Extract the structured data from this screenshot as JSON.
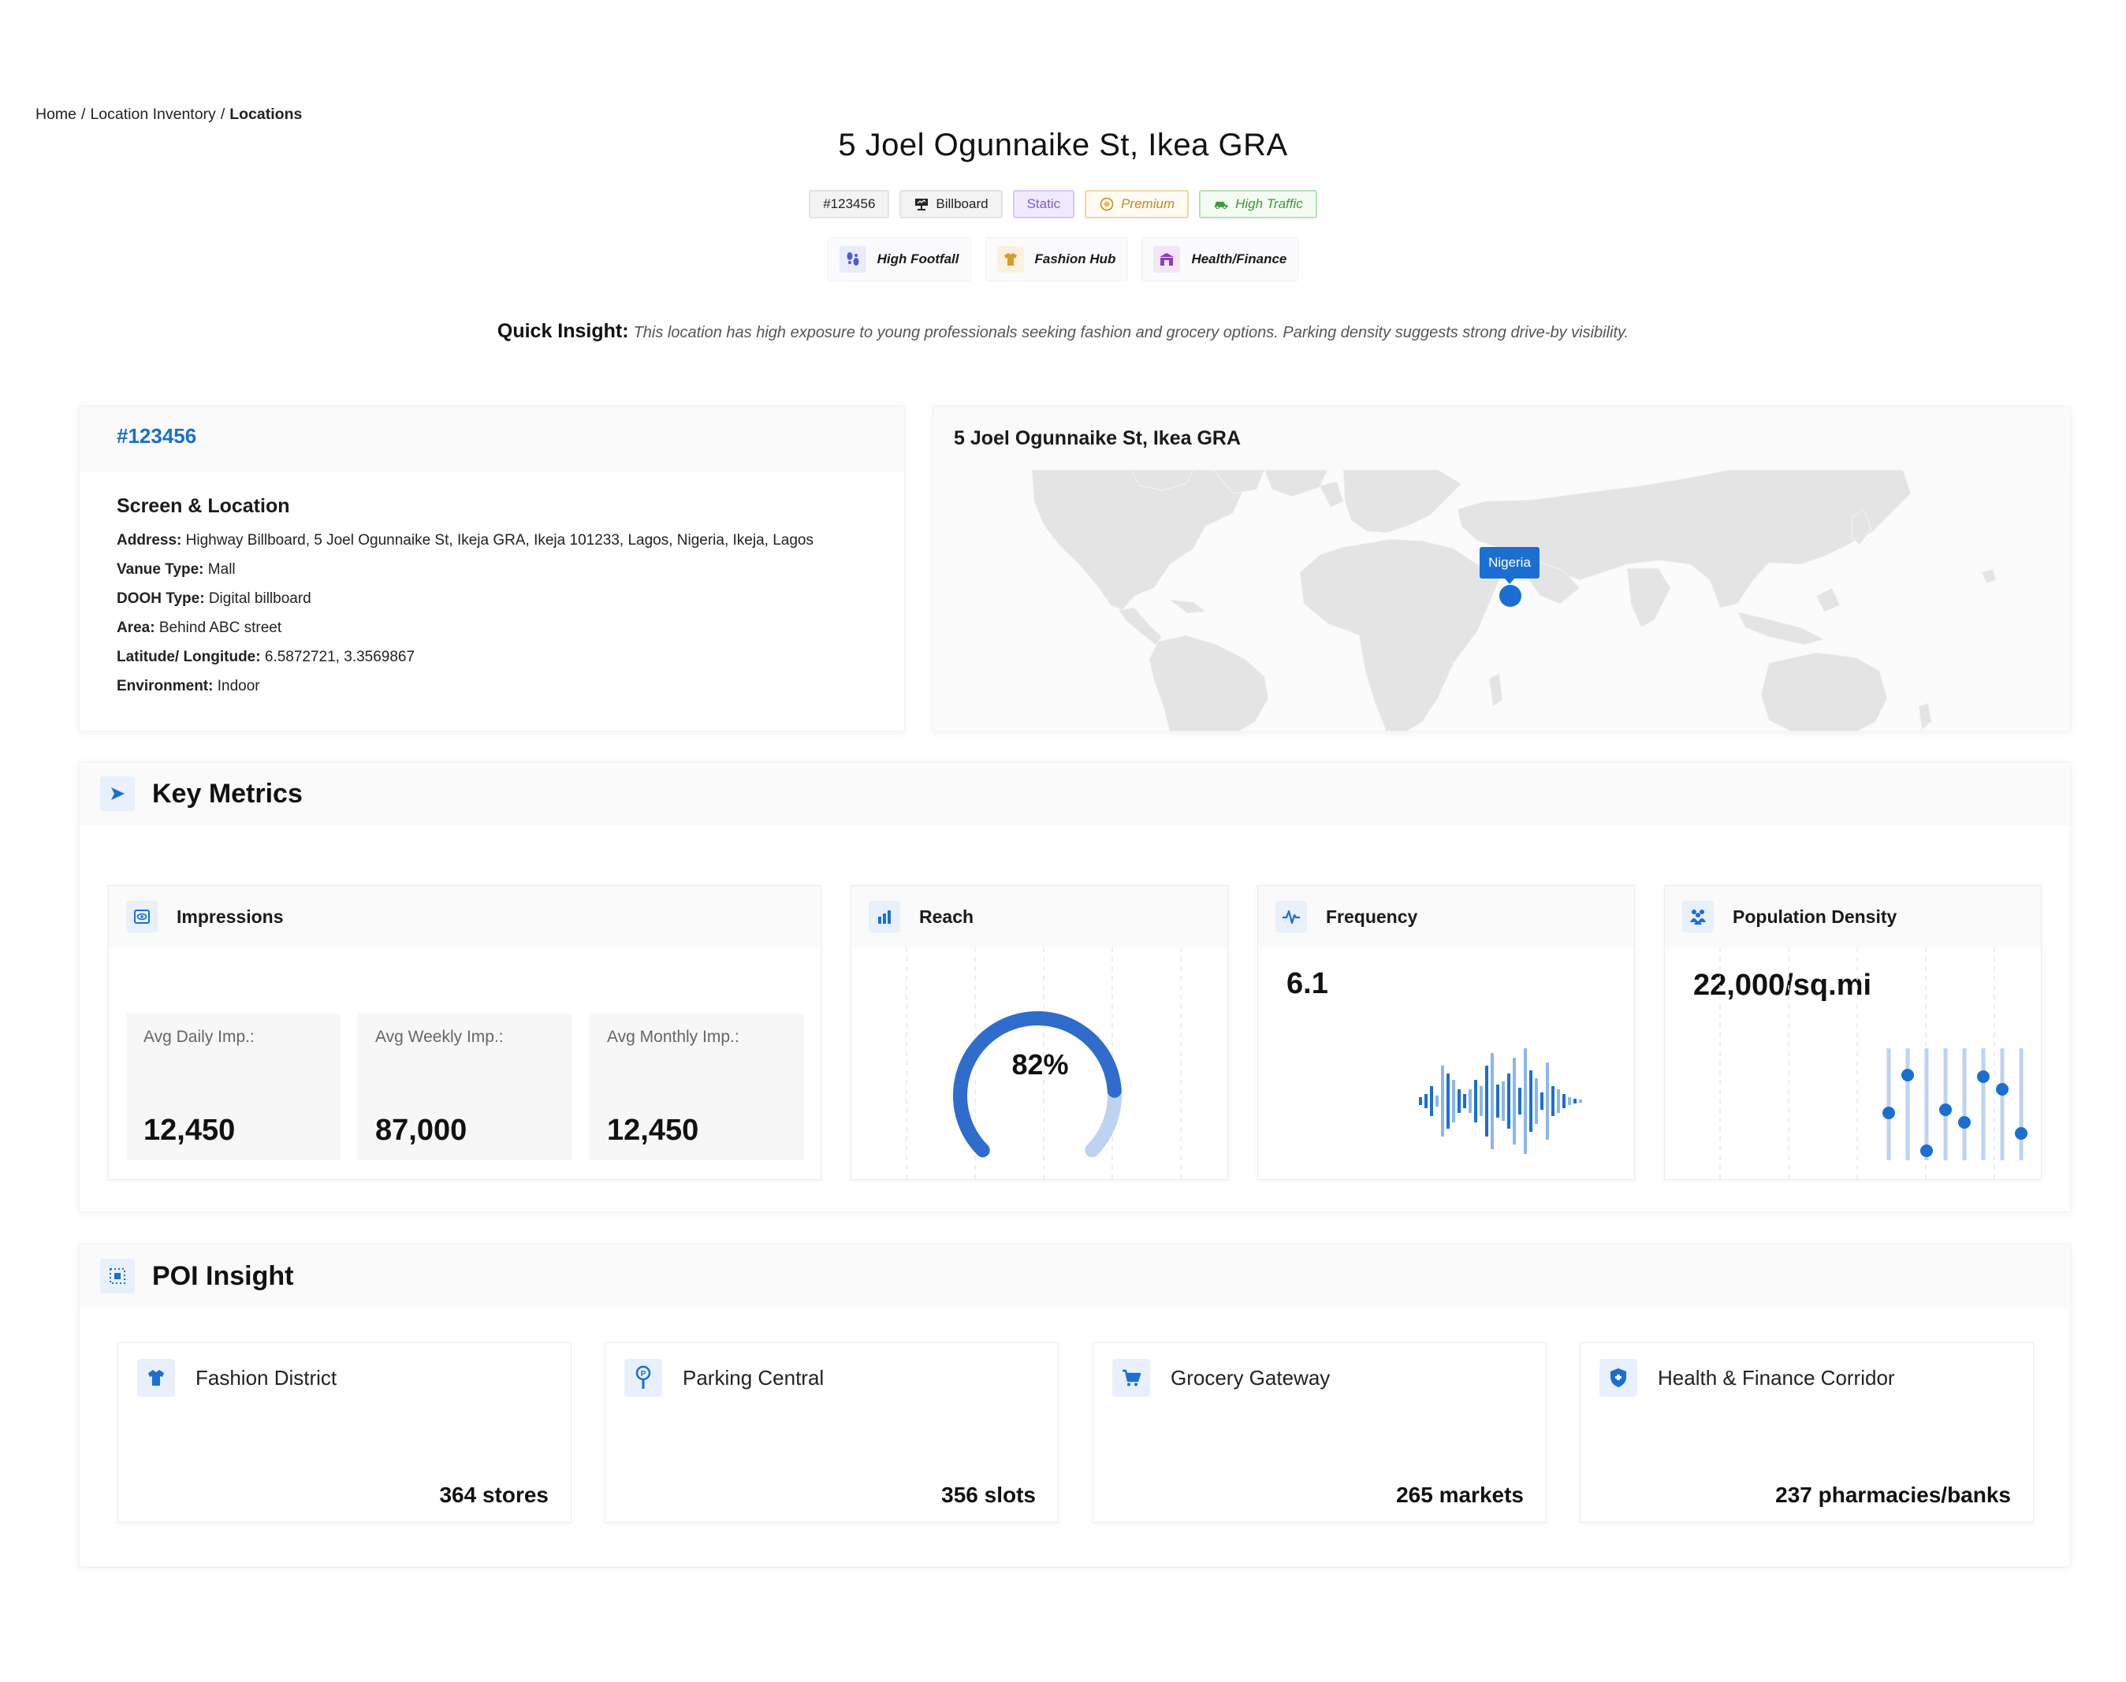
{
  "breadcrumb": {
    "items": [
      "Home",
      "Location Inventory"
    ],
    "current": "Locations"
  },
  "title": "5 Joel Ogunnaike St, Ikea GRA",
  "tags": {
    "id": "#123456",
    "format": "Billboard",
    "type": "Static",
    "tier": "Premium",
    "traffic": "High Traffic"
  },
  "profile_tags": [
    "High Footfall",
    "Fashion Hub",
    "Health/Finance"
  ],
  "insight": {
    "label": "Quick Insight:",
    "text": "This location has high exposure to young professionals seeking fashion and grocery options. Parking density suggests strong drive-by visibility."
  },
  "info": {
    "code": "#123456",
    "heading": "Screen & Location",
    "rows": [
      {
        "label": "Address:",
        "value": "Highway Billboard, 5 Joel Ogunnaike St, Ikeja GRA, Ikeja 101233, Lagos, Nigeria, Ikeja, Lagos"
      },
      {
        "label": "Vanue Type:",
        "value": "Mall"
      },
      {
        "label": "DOOH Type:",
        "value": "Digital billboard"
      },
      {
        "label": "Area:",
        "value": "Behind ABC street"
      },
      {
        "label": "Latitude/ Longitude:",
        "value": "6.5872721, 3.3569867"
      },
      {
        "label": "Environment:",
        "value": "Indoor"
      }
    ]
  },
  "map": {
    "title": "5 Joel Ogunnaike St, Ikea GRA",
    "marker_label": "Nigeria",
    "land_color": "#e4e4e4",
    "marker_color": "#1a6fd1"
  },
  "metrics": {
    "title": "Key Metrics",
    "impressions": {
      "title": "Impressions",
      "stats": [
        {
          "label": "Avg Daily Imp.:",
          "value": "12,450"
        },
        {
          "label": "Avg Weekly Imp.:",
          "value": "87,000"
        },
        {
          "label": "Avg Monthly Imp.:",
          "value": "12,450"
        }
      ]
    },
    "reach": {
      "title": "Reach",
      "value": "82%",
      "percent": 82
    },
    "frequency": {
      "title": "Frequency",
      "value": "6.1"
    },
    "density": {
      "title": "Population Density",
      "value": "22,000/sq.mi"
    }
  },
  "poi": {
    "title": "POI Insight",
    "items": [
      {
        "name": "Fashion District",
        "value": "364 stores",
        "icon": "shirt-icon"
      },
      {
        "name": "Parking Central",
        "value": "356 slots",
        "icon": "parking-pin-icon"
      },
      {
        "name": "Grocery Gateway",
        "value": "265 markets",
        "icon": "cart-icon"
      },
      {
        "name": "Health & Finance Corridor",
        "value": "237 pharmacies/banks",
        "icon": "shield-icon"
      }
    ]
  },
  "colors": {
    "accent": "#1a6fd1",
    "accent_light": "#bcd3f2",
    "card_header": "#fafafa"
  }
}
